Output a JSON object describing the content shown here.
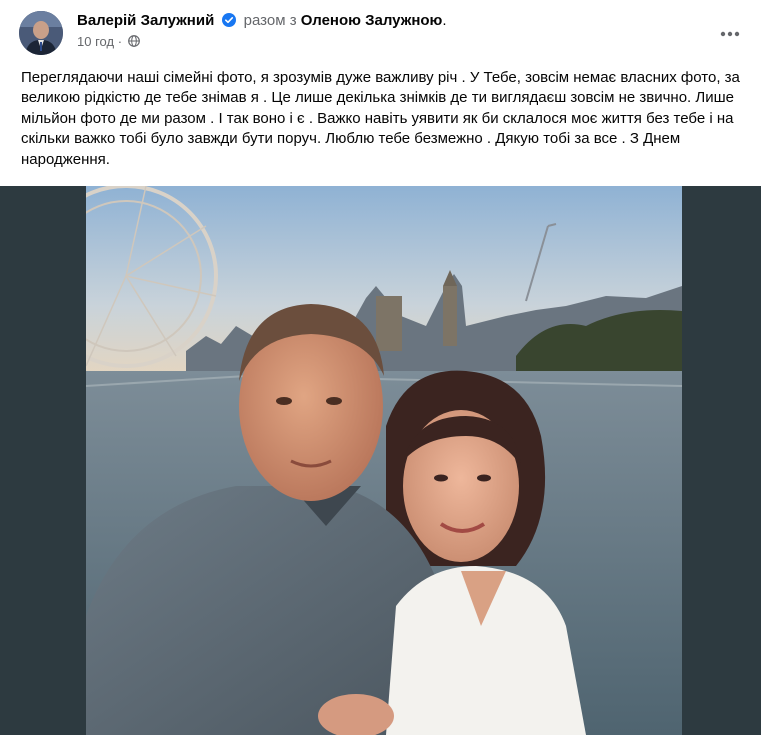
{
  "post": {
    "author": "Валерій Залужний",
    "with_text": "разом з",
    "tagged": "Оленою Залужною",
    "period": ".",
    "time": "10 год",
    "time_separator": "·",
    "body": "Переглядаючи наші сімейні фото, я зрозумів дуже важливу річ . У Тебе, зовсім немає власних фото, за великою рідкістю де тебе знімав я . Це лише декілька знімків де ти виглядаєш зовсім не звично. Лише мільйон фото де ми разом . І так воно і є . Важко навіть уявити як би склалося моє життя без тебе і на скільки важко тобі було завжди бути поруч. Люблю тебе безмежно . Дякую тобі за все . З Днем народження."
  },
  "icons": {
    "verified": "verified-badge-icon",
    "privacy": "globe-icon",
    "more": "more-horizontal-icon"
  },
  "colors": {
    "verified_blue": "#1877f2",
    "secondary_text": "#65676b",
    "photo_frame": "#2d3a40"
  }
}
